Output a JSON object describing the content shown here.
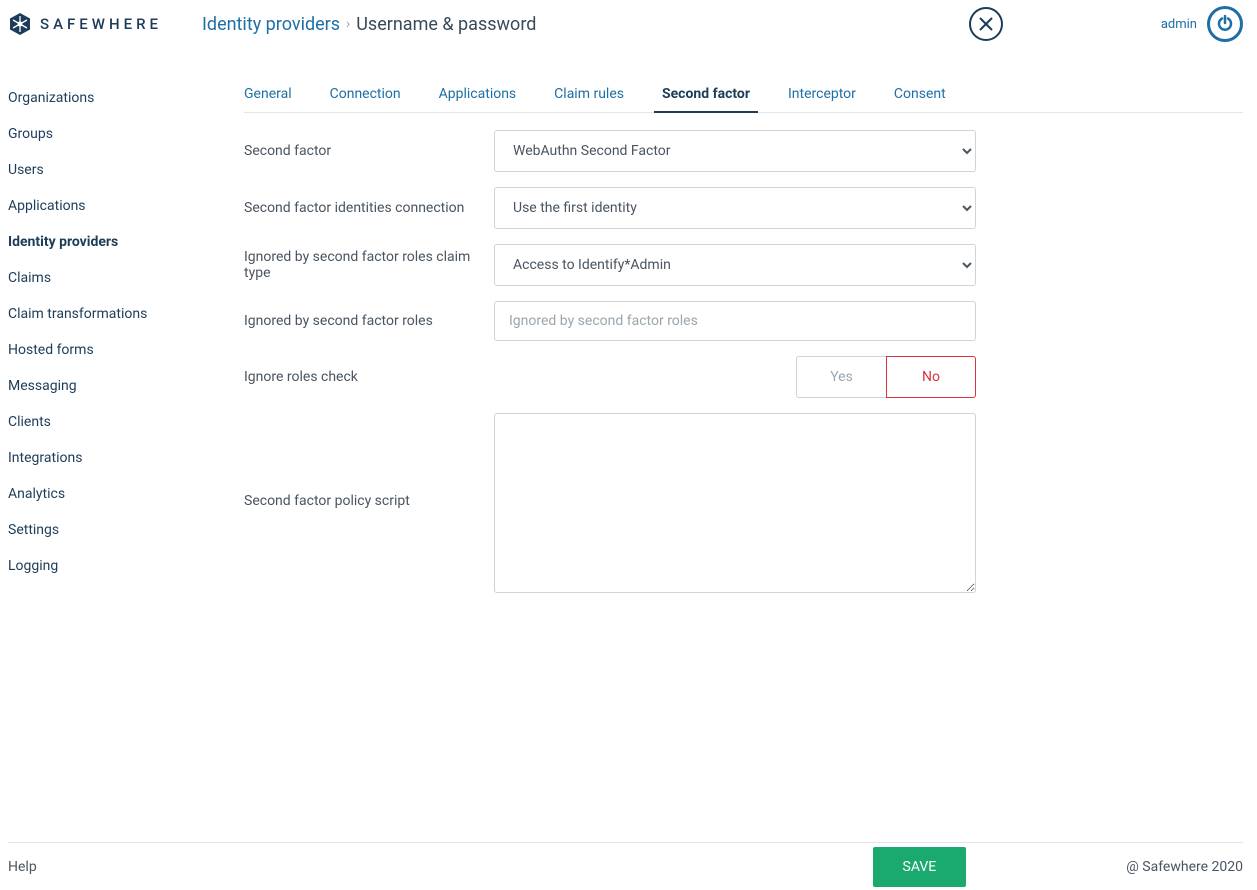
{
  "brand": "SAFEWHERE",
  "breadcrumb": {
    "parent": "Identity providers",
    "current": "Username & password"
  },
  "user": "admin",
  "sidebar": [
    {
      "label": "Organizations",
      "active": false
    },
    {
      "label": "Groups",
      "active": false
    },
    {
      "label": "Users",
      "active": false
    },
    {
      "label": "Applications",
      "active": false
    },
    {
      "label": "Identity providers",
      "active": true
    },
    {
      "label": "Claims",
      "active": false
    },
    {
      "label": "Claim transformations",
      "active": false
    },
    {
      "label": "Hosted forms",
      "active": false
    },
    {
      "label": "Messaging",
      "active": false
    },
    {
      "label": "Clients",
      "active": false
    },
    {
      "label": "Integrations",
      "active": false
    },
    {
      "label": "Analytics",
      "active": false
    },
    {
      "label": "Settings",
      "active": false
    },
    {
      "label": "Logging",
      "active": false
    }
  ],
  "tabs": [
    {
      "label": "General",
      "active": false
    },
    {
      "label": "Connection",
      "active": false
    },
    {
      "label": "Applications",
      "active": false
    },
    {
      "label": "Claim rules",
      "active": false
    },
    {
      "label": "Second factor",
      "active": true
    },
    {
      "label": "Interceptor",
      "active": false
    },
    {
      "label": "Consent",
      "active": false
    }
  ],
  "form": {
    "second_factor": {
      "label": "Second factor",
      "value": "WebAuthn Second Factor"
    },
    "identities_connection": {
      "label": "Second factor identities connection",
      "value": "Use the first identity"
    },
    "roles_claim_type": {
      "label": "Ignored by second factor roles claim type",
      "value": "Access to Identify*Admin"
    },
    "ignored_roles": {
      "label": "Ignored by second factor roles",
      "placeholder": "Ignored by second factor roles",
      "value": ""
    },
    "ignore_roles_check": {
      "label": "Ignore roles check",
      "yes": "Yes",
      "no": "No",
      "value": "No"
    },
    "policy_script": {
      "label": "Second factor policy script",
      "value": ""
    }
  },
  "footer": {
    "help": "Help",
    "save": "SAVE",
    "copyright": "@ Safewhere 2020"
  }
}
